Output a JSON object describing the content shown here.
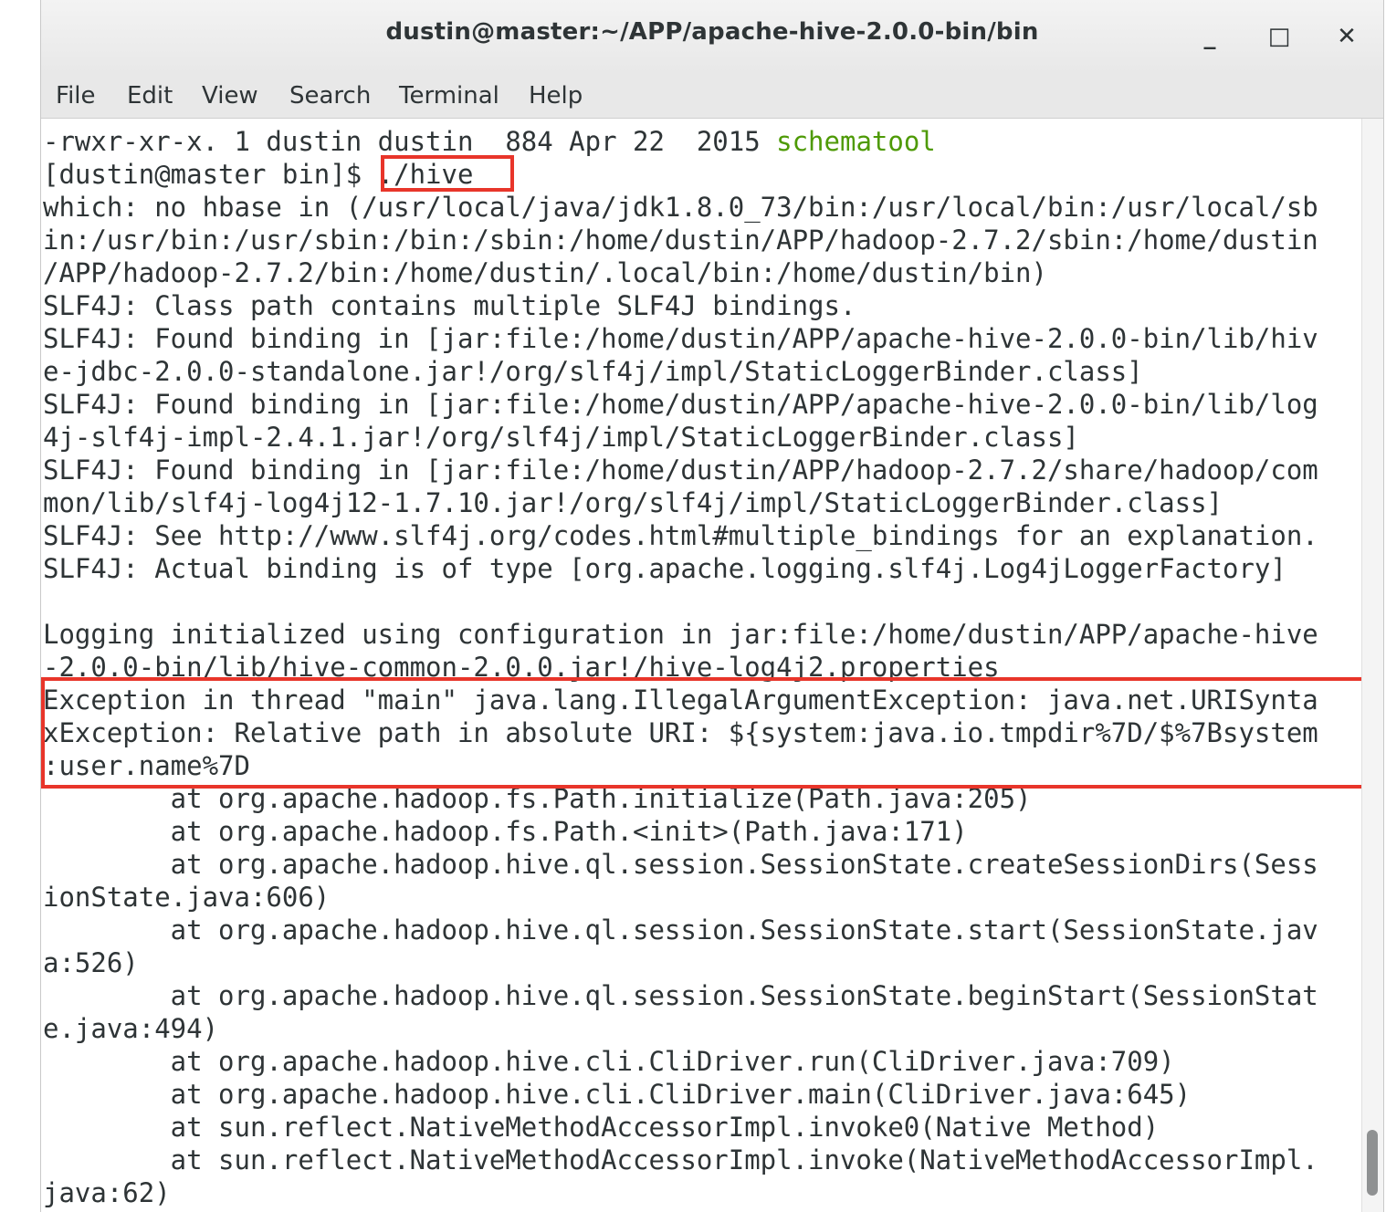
{
  "window": {
    "title": "dustin@master:~/APP/apache-hive-2.0.0-bin/bin",
    "minimize_glyph": "_",
    "maximize_glyph": "□",
    "close_glyph": "✕"
  },
  "menu": [
    "File",
    "Edit",
    "View",
    "Search",
    "Terminal",
    "Help"
  ],
  "terminal": {
    "line1_prefix": "-rwxr-xr-x. 1 dustin dustin  884 Apr 22  2015 ",
    "line1_file": "schematool",
    "prompt": "[dustin@master bin]$ ",
    "command": "./hive ",
    "lines": [
      "which: no hbase in (/usr/local/java/jdk1.8.0_73/bin:/usr/local/bin:/usr/local/sb",
      "in:/usr/bin:/usr/sbin:/bin:/sbin:/home/dustin/APP/hadoop-2.7.2/sbin:/home/dustin",
      "/APP/hadoop-2.7.2/bin:/home/dustin/.local/bin:/home/dustin/bin)",
      "SLF4J: Class path contains multiple SLF4J bindings.",
      "SLF4J: Found binding in [jar:file:/home/dustin/APP/apache-hive-2.0.0-bin/lib/hiv",
      "e-jdbc-2.0.0-standalone.jar!/org/slf4j/impl/StaticLoggerBinder.class]",
      "SLF4J: Found binding in [jar:file:/home/dustin/APP/apache-hive-2.0.0-bin/lib/log",
      "4j-slf4j-impl-2.4.1.jar!/org/slf4j/impl/StaticLoggerBinder.class]",
      "SLF4J: Found binding in [jar:file:/home/dustin/APP/hadoop-2.7.2/share/hadoop/com",
      "mon/lib/slf4j-log4j12-1.7.10.jar!/org/slf4j/impl/StaticLoggerBinder.class]",
      "SLF4J: See http://www.slf4j.org/codes.html#multiple_bindings for an explanation.",
      "SLF4J: Actual binding is of type [org.apache.logging.slf4j.Log4jLoggerFactory]",
      "",
      "Logging initialized using configuration in jar:file:/home/dustin/APP/apache-hive",
      "-2.0.0-bin/lib/hive-common-2.0.0.jar!/hive-log4j2.properties",
      "Exception in thread \"main\" java.lang.IllegalArgumentException: java.net.URISynta",
      "xException: Relative path in absolute URI: ${system:java.io.tmpdir%7D/$%7Bsystem",
      ":user.name%7D",
      "        at org.apache.hadoop.fs.Path.initialize(Path.java:205)",
      "        at org.apache.hadoop.fs.Path.<init>(Path.java:171)",
      "        at org.apache.hadoop.hive.ql.session.SessionState.createSessionDirs(Sess",
      "ionState.java:606)",
      "        at org.apache.hadoop.hive.ql.session.SessionState.start(SessionState.jav",
      "a:526)",
      "        at org.apache.hadoop.hive.ql.session.SessionState.beginStart(SessionStat",
      "e.java:494)",
      "        at org.apache.hadoop.hive.cli.CliDriver.run(CliDriver.java:709)",
      "        at org.apache.hadoop.hive.cli.CliDriver.main(CliDriver.java:645)",
      "        at sun.reflect.NativeMethodAccessorImpl.invoke0(Native Method)",
      "        at sun.reflect.NativeMethodAccessorImpl.invoke(NativeMethodAccessorImpl.",
      "java:62)"
    ]
  },
  "colors": {
    "file_executable": "#4e9a06",
    "highlight_box": "#e8352a",
    "text": "#2e3436"
  }
}
